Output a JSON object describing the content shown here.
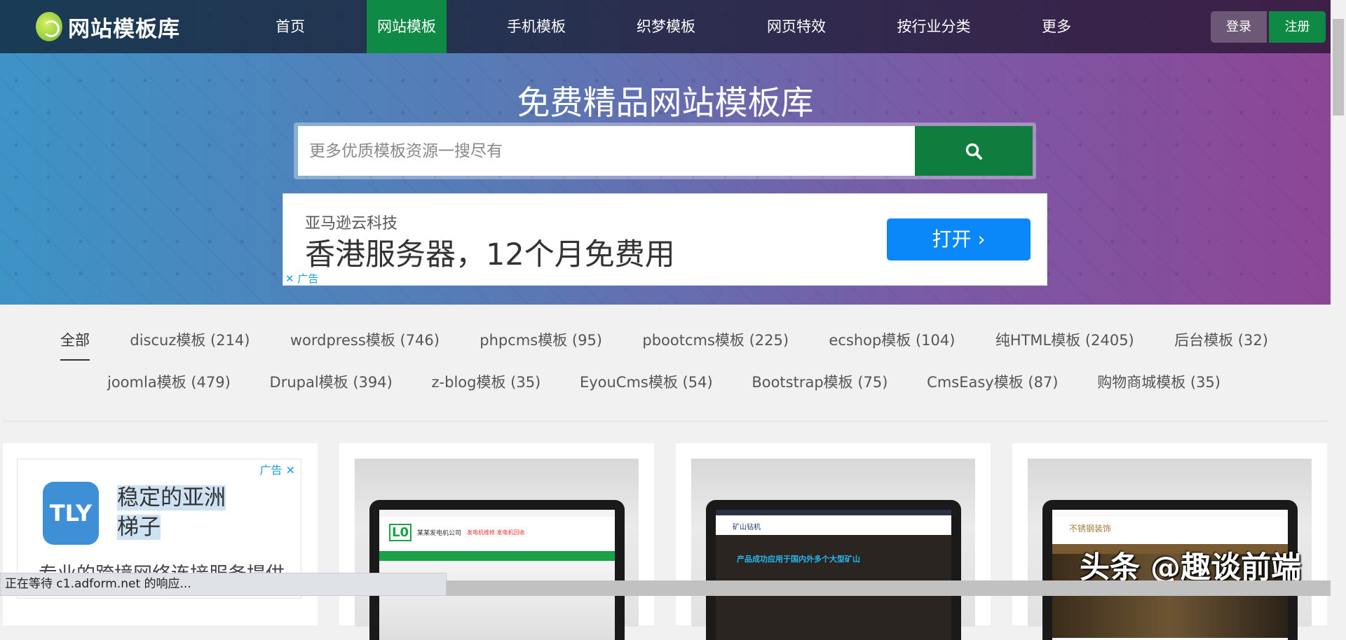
{
  "nav": {
    "logo_text": "网站模板库",
    "items": [
      "首页",
      "网站模板",
      "手机模板",
      "织梦模板",
      "网页特效",
      "按行业分类",
      "更多"
    ],
    "active": "网站模板",
    "login": "登录",
    "register": "注册"
  },
  "hero": {
    "title": "免费精品网站模板库",
    "search_placeholder": "更多优质模板资源一搜尽有"
  },
  "banner_ad": {
    "brand": "亚马逊云科技",
    "headline": "香港服务器，12个月免费用",
    "button": "打开 ›",
    "tag": "✕ 广告"
  },
  "categories": {
    "row1": [
      "全部",
      "discuz模板 (214)",
      "wordpress模板 (746)",
      "phpcms模板 (95)",
      "pbootcms模板 (225)",
      "ecshop模板 (104)",
      "纯HTML模板 (2405)",
      "后台模板 (32)"
    ],
    "row2": [
      "joomla模板 (479)",
      "Drupal模板 (394)",
      "z-blog模板 (35)",
      "EyouCms模板 (54)",
      "Bootstrap模板 (75)",
      "CmsEasy模板 (87)",
      "购物商城模板 (35)"
    ]
  },
  "card_ad": {
    "tag": "广告 ✕",
    "logo": "TLY",
    "title1": "稳定的亚洲",
    "title2": "梯子",
    "desc": "专业的跨境网络连接服务提供"
  },
  "thumbs": [
    {
      "company": "某某发电机公司",
      "accent": "#1aa346"
    },
    {
      "company": "矿山钻机",
      "headline": "产品成功应用于国内外多个大型矿山",
      "accent": "#1b2233"
    },
    {
      "company": "不锈钢装饰",
      "accent": "#8a6a3a"
    }
  ],
  "watermark": "头条 @趣谈前端",
  "status_text": "正在等待 c1.adform.net 的响应..."
}
